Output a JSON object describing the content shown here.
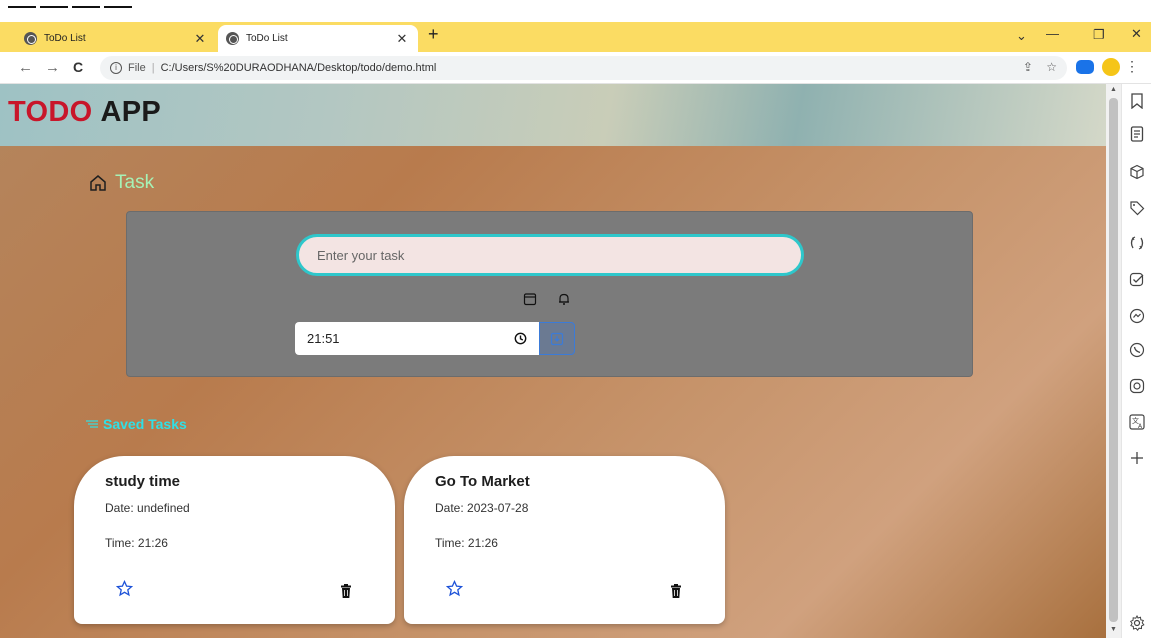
{
  "browser": {
    "tabs": [
      {
        "title": "ToDo List",
        "active": false
      },
      {
        "title": "ToDo List",
        "active": true
      }
    ],
    "new_tab": "+",
    "address": {
      "scheme": "File",
      "url": "C:/Users/S%20DURAODHANA/Desktop/todo/demo.html"
    }
  },
  "app": {
    "brand_part1": "TODO",
    "brand_part2": "APP",
    "task_heading": "Task",
    "task_input_placeholder": "Enter your task",
    "time_value": "21:51",
    "saved_heading": "Saved Tasks"
  },
  "cards": [
    {
      "title": "study time",
      "date": "Date: undefined",
      "time": "Time: 21:26"
    },
    {
      "title": "Go To Market",
      "date": "Date: 2023-07-28",
      "time": "Time: 21:26"
    }
  ],
  "colors": {
    "tab_strip": "#fbdc63",
    "brand_red": "#c8162a",
    "task_heading": "#a6f2b6",
    "input_border": "#2ec7cb",
    "saved_heading": "#2fe0e6",
    "star_blue": "#1d52d8"
  },
  "icons": {
    "side_panel": [
      "bookmark-icon",
      "reading-list-icon",
      "box-icon",
      "tag-icon",
      "sync-icon",
      "tasks-icon",
      "messenger-icon",
      "whatsapp-icon",
      "instagram-icon",
      "translate-icon",
      "plus-icon",
      "gear-icon"
    ]
  }
}
